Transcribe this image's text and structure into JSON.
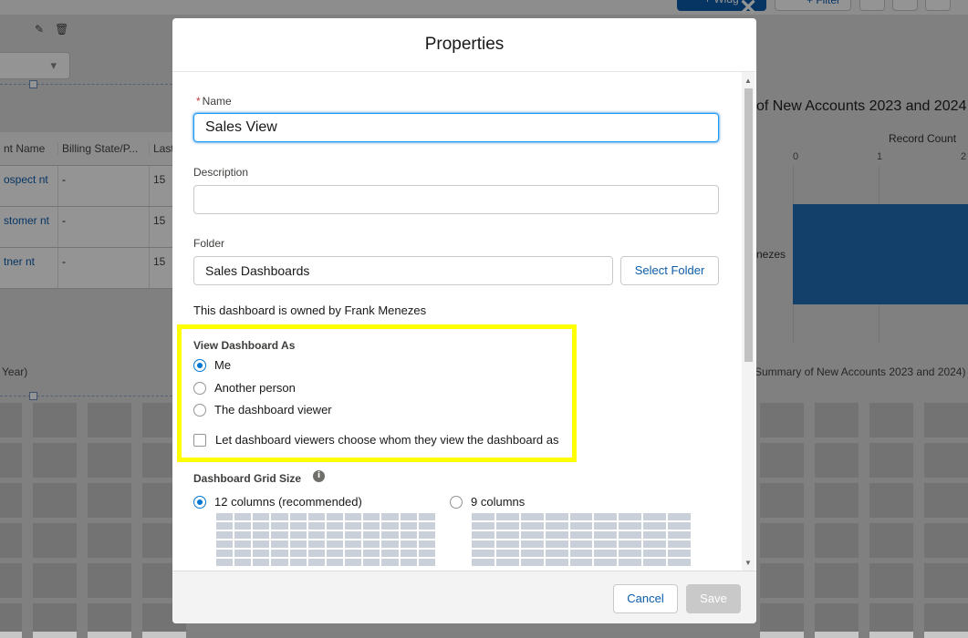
{
  "background": {
    "add_button": "+ Widg",
    "filter_button": "+ Filter",
    "table_headers": [
      "nt Name",
      "Billing State/P...",
      "Last"
    ],
    "table_rows": [
      {
        "name": "ospect nt",
        "state": "-",
        "last": "15"
      },
      {
        "name": "stomer nt",
        "state": "-",
        "last": "15"
      },
      {
        "name": "tner nt",
        "state": "-",
        "last": "15"
      }
    ],
    "year_text": "Year)",
    "chart": {
      "title": "of New Accounts 2023 and 2024",
      "axis_label": "Record Count",
      "ticks": [
        "0",
        "1",
        "2"
      ],
      "bar_label": "nezes",
      "summary": "Summary of New Accounts 2023 and 2024)"
    }
  },
  "modal": {
    "title": "Properties",
    "name": {
      "label": "Name",
      "required_mark": "*",
      "value": "Sales View"
    },
    "description": {
      "label": "Description",
      "value": ""
    },
    "folder": {
      "label": "Folder",
      "value": "Sales Dashboards",
      "select_button": "Select Folder"
    },
    "owner_text": "This dashboard is owned by Frank Menezes",
    "view_as": {
      "title": "View Dashboard As",
      "options": [
        {
          "label": "Me",
          "checked": true
        },
        {
          "label": "Another person",
          "checked": false
        },
        {
          "label": "The dashboard viewer",
          "checked": false
        }
      ],
      "checkbox_label": "Let dashboard viewers choose whom they view the dashboard as"
    },
    "grid_size": {
      "title": "Dashboard Grid Size",
      "info_glyph": "i",
      "option_12": "12 columns (recommended)",
      "option_9": "9 columns",
      "selected": "12"
    },
    "footer": {
      "cancel": "Cancel",
      "save": "Save"
    }
  },
  "colors": {
    "highlight": "#ffff00",
    "brand": "#0176d3"
  }
}
